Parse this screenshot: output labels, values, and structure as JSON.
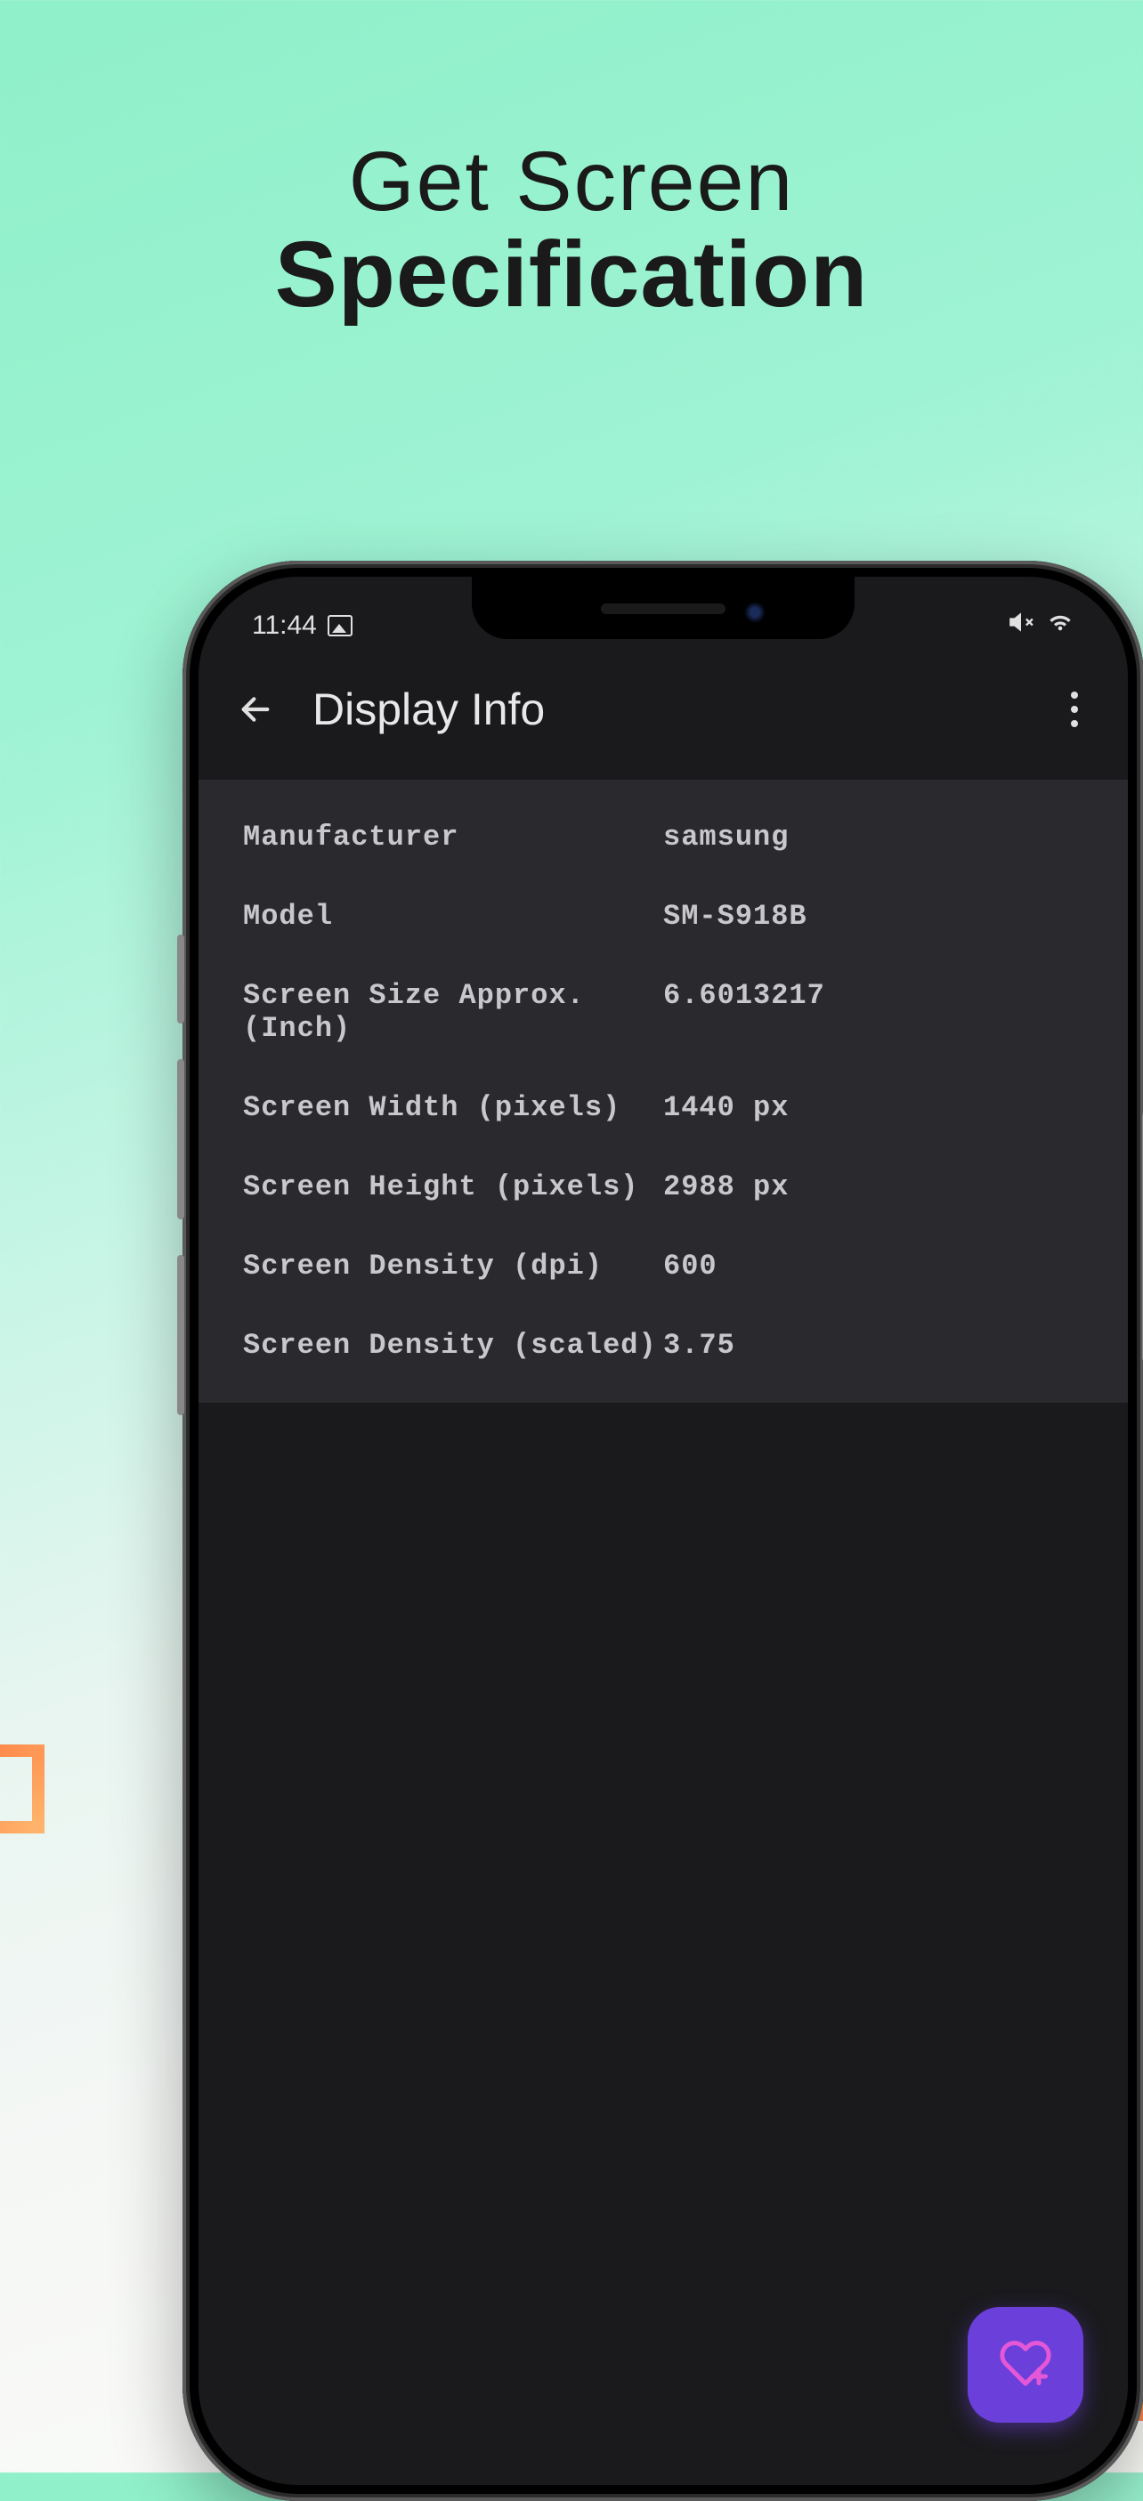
{
  "promo": {
    "line1": "Get Screen",
    "line2": "Specification"
  },
  "status_bar": {
    "time": "11:44"
  },
  "header": {
    "title": "Display Info"
  },
  "info": {
    "rows": [
      {
        "label": "Manufacturer",
        "value": "samsung"
      },
      {
        "label": "Model",
        "value": "SM-S918B"
      },
      {
        "label": "Screen Size Approx. (Inch)",
        "value": "6.6013217"
      },
      {
        "label": "Screen Width (pixels)",
        "value": "1440 px"
      },
      {
        "label": "Screen Height (pixels)",
        "value": "2988 px"
      },
      {
        "label": "Screen Density (dpi)",
        "value": "600"
      },
      {
        "label": "Screen Density (scaled)",
        "value": "3.75"
      }
    ]
  }
}
